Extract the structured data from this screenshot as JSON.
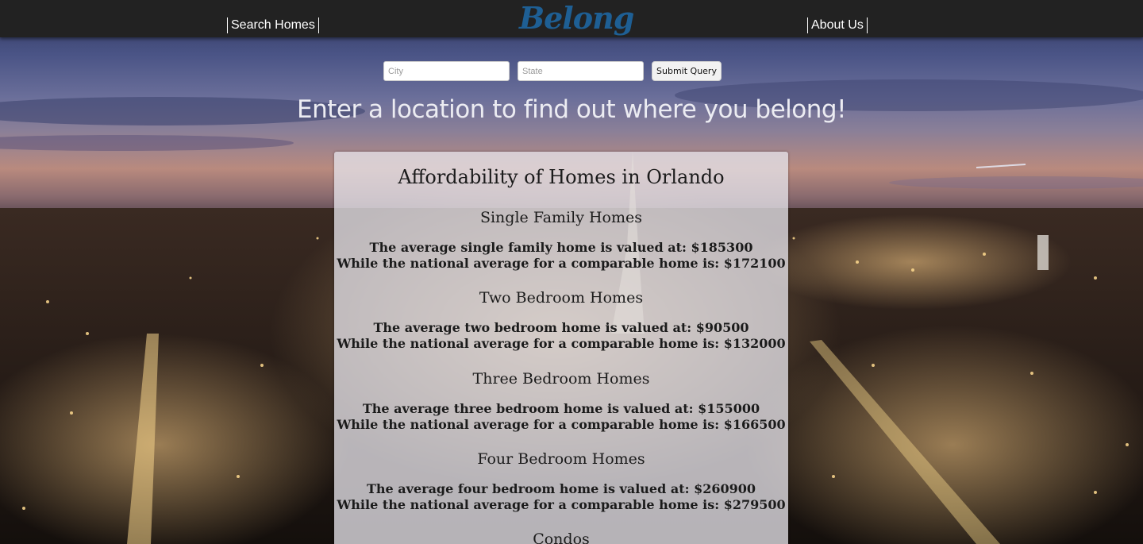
{
  "navbar": {
    "search_label": "Search Homes",
    "logo_text": "Belong",
    "about_label": "About Us"
  },
  "search": {
    "city_placeholder": "City",
    "state_placeholder": "State",
    "submit_label": "Submit Query"
  },
  "tagline": "Enter a location to find out where you belong!",
  "results": {
    "title": "Affordability of Homes in Orlando",
    "sections": [
      {
        "heading": "Single Family Homes",
        "line1": "The average single family home is valued at: $185300",
        "line2": "While the national average for a comparable home is: $172100"
      },
      {
        "heading": "Two Bedroom Homes",
        "line1": "The average two bedroom home is valued at: $90500",
        "line2": "While the national average for a comparable home is: $132000"
      },
      {
        "heading": "Three Bedroom Homes",
        "line1": "The average three bedroom home is valued at: $155000",
        "line2": "While the national average for a comparable home is: $166500"
      },
      {
        "heading": "Four Bedroom Homes",
        "line1": "The average four bedroom home is valued at: $260900",
        "line2": "While the national average for a comparable home is: $279500"
      },
      {
        "heading": "Condos",
        "line1": "",
        "line2": ""
      }
    ]
  },
  "colors": {
    "navbar_bg": "#222222",
    "logo": "#1e5f94",
    "tagline": "#ececf2"
  }
}
